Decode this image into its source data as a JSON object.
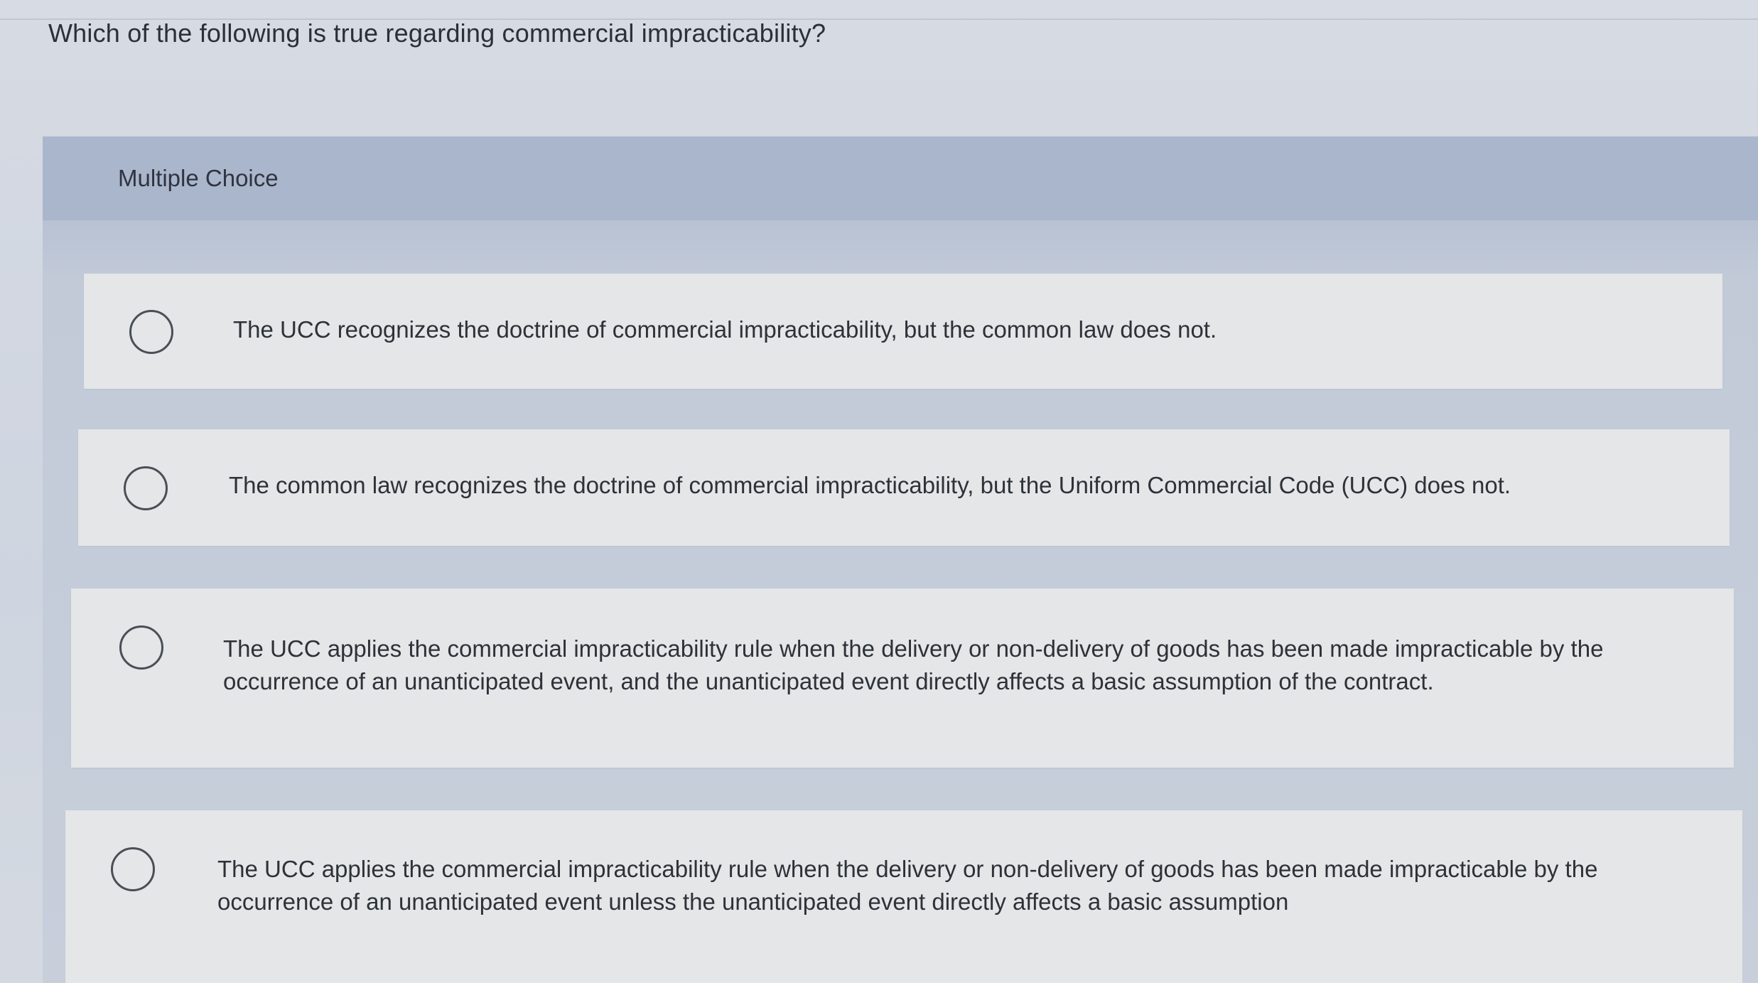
{
  "question": {
    "text": "Which of the following is true regarding commercial impracticability?"
  },
  "panel": {
    "label": "Multiple Choice"
  },
  "options": [
    {
      "text": "The UCC recognizes the doctrine of commercial impracticability, but the common law does not.",
      "selected": false
    },
    {
      "text": "The common law recognizes the doctrine of commercial impracticability, but the Uniform Commercial Code (UCC) does not.",
      "selected": false
    },
    {
      "text": "The UCC applies the commercial impracticability rule when the delivery or non-delivery of goods has been made impracticable by the occurrence of an unanticipated event, and the unanticipated event directly affects a basic assumption of the contract.",
      "selected": false
    },
    {
      "text": "The UCC applies the commercial impracticability rule when the delivery or non-delivery of goods has been made impracticable by the occurrence of an unanticipated event unless the unanticipated event directly affects a basic assumption",
      "selected": false
    }
  ]
}
